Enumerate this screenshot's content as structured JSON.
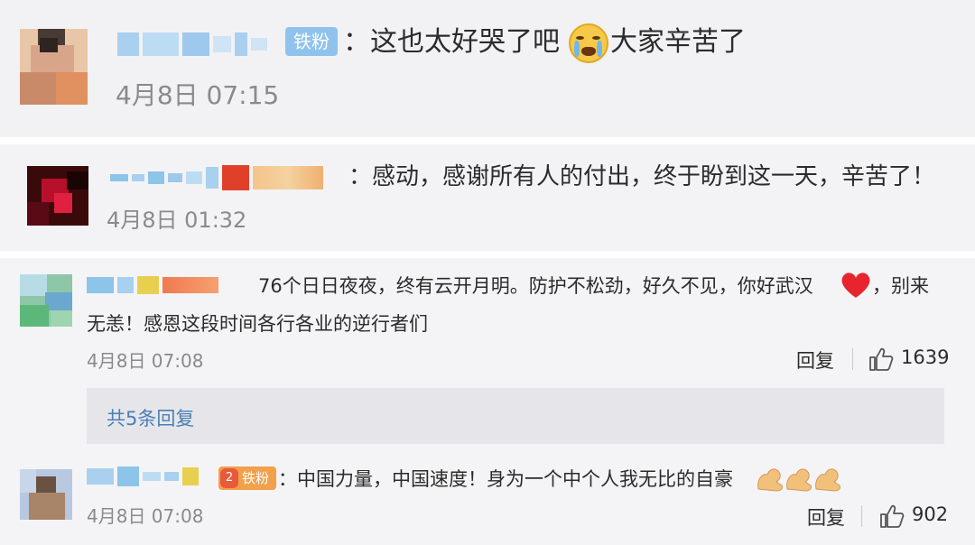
{
  "comments": [
    {
      "text": "：这也太好哭了吧",
      "text2": "大家辛苦了",
      "time": "4月8日 07:15",
      "badge": "铁粉"
    },
    {
      "text": "：感动，感谢所有人的付出，终于盼到这一天，辛苦了！",
      "time": "4月8日 01:32"
    },
    {
      "text_line1": "76个日日夜夜，终有云开月明。防护不松劲，好久不见，你好武汉",
      "text_line1_tail": "，别来",
      "text_line2": "无恙！感恩这段时间各行各业的逆行者们",
      "time": "4月8日 07:08",
      "reply_label": "回复",
      "like_count": "1639",
      "replies_link": "共5条回复"
    },
    {
      "text": "：中国力量，中国速度！身为一个中个人我无比的自豪",
      "time": "4月8日 07:08",
      "badge": "铁粉",
      "badge_level": "2",
      "reply_label": "回复",
      "like_count": "902"
    }
  ],
  "colors": {
    "panel": "#f2f2f4",
    "name_blue": "#8cc4ea",
    "link": "#4a7fb5",
    "time": "#8a8a8a"
  },
  "icons": [
    "crying-face-icon",
    "red-heart-icon",
    "flexed-arm-icon",
    "thumbs-up-icon"
  ]
}
